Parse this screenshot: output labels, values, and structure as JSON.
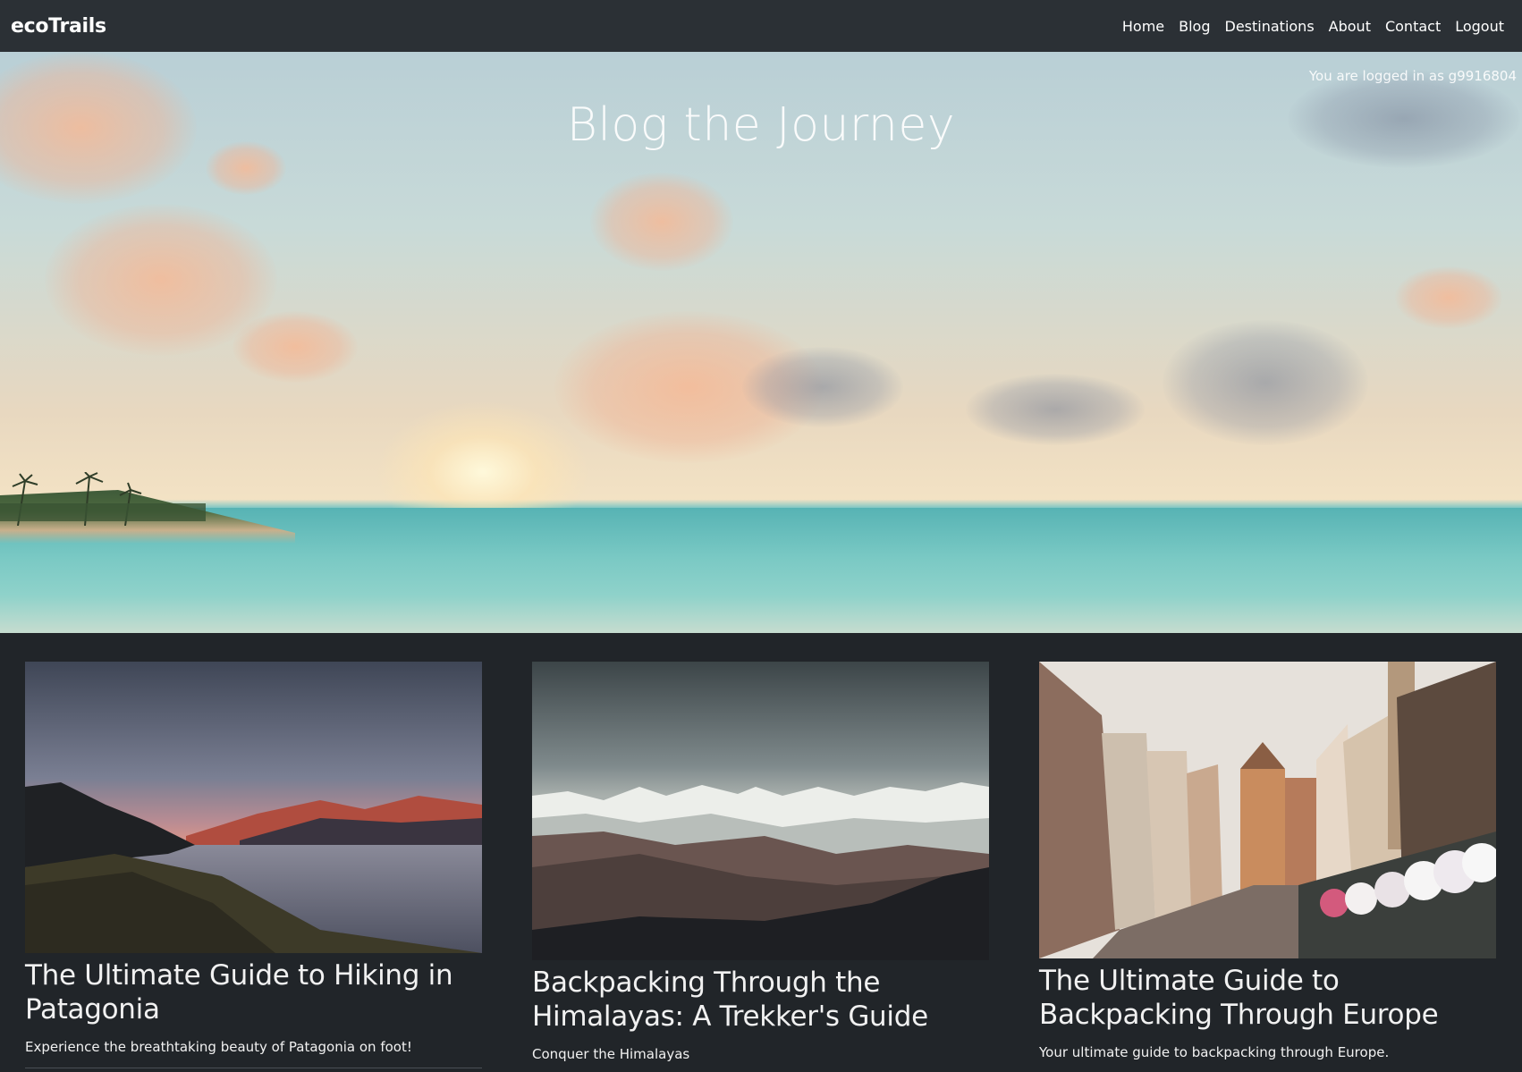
{
  "navbar": {
    "brand": "ecoTrails",
    "links": [
      "Home",
      "Blog",
      "Destinations",
      "About",
      "Contact",
      "Logout"
    ]
  },
  "hero": {
    "title": "Blog the Journey",
    "login_status": "You are logged in as g9916804"
  },
  "posts": [
    {
      "title": "The Ultimate Guide to Hiking in Patagonia",
      "description": "Experience the breathtaking beauty of Patagonia on foot!"
    },
    {
      "title": "Backpacking Through the Himalayas: A Trekker's Guide",
      "description": "Conquer the Himalayas"
    },
    {
      "title": "The Ultimate Guide to Backpacking Through Europe",
      "description": "Your ultimate guide to backpacking through Europe."
    }
  ],
  "colors": {
    "background": "#212529",
    "navbar": "#2b3035",
    "text": "#f8f9fa"
  }
}
